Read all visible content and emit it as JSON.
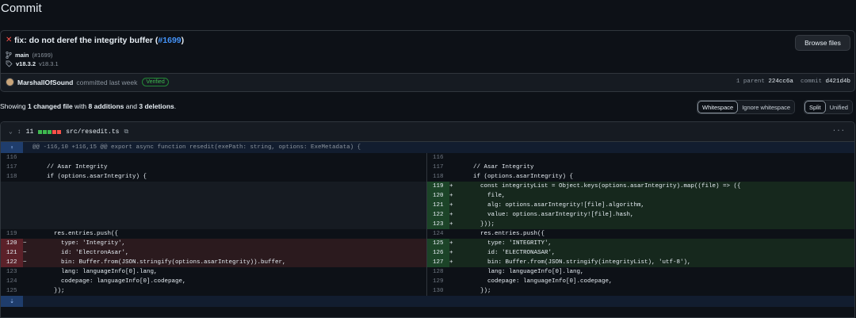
{
  "page": {
    "title": "Commit"
  },
  "commit": {
    "message": "fix: do not deref the integrity buffer (",
    "pr_link": "#1699",
    "message_end": ")",
    "branch": "main",
    "branch_pr": "(#1699)",
    "tag": "v18.3.2",
    "tag_prev": "v18.3.1",
    "browse_label": "Browse files",
    "author": "MarshallOfSound",
    "committed_text": "committed last week",
    "verified_label": "Verified",
    "parent_label": "1 parent",
    "parent_hash": "224cc6a",
    "commit_label": "commit",
    "commit_hash": "d421d4b"
  },
  "summary": {
    "prefix": "Showing",
    "files": "1 changed file",
    "with": "with",
    "additions": "8 additions",
    "and": "and",
    "deletions": "3 deletions",
    "end": "."
  },
  "toggles": {
    "whitespace": "Whitespace",
    "ignore_whitespace": "Ignore whitespace",
    "split": "Split",
    "unified": "Unified"
  },
  "file": {
    "changes": "11",
    "path": "src/resedit.ts",
    "hunk_header": "@@ -116,10 +116,15 @@ export async function resedit(exePath: string, options: ExeMetadata) {",
    "left_lines": [
      {
        "n": "116",
        "m": "",
        "t": "",
        "type": "ctx"
      },
      {
        "n": "117",
        "m": "",
        "t": "    // Asar Integrity",
        "type": "ctx"
      },
      {
        "n": "118",
        "m": "",
        "t": "    if (options.asarIntegrity) {",
        "type": "ctx"
      },
      {
        "n": "",
        "m": "",
        "t": "",
        "type": "empty"
      },
      {
        "n": "",
        "m": "",
        "t": "",
        "type": "empty"
      },
      {
        "n": "",
        "m": "",
        "t": "",
        "type": "empty"
      },
      {
        "n": "",
        "m": "",
        "t": "",
        "type": "empty"
      },
      {
        "n": "",
        "m": "",
        "t": "",
        "type": "empty"
      },
      {
        "n": "119",
        "m": "",
        "t": "      res.entries.push({",
        "type": "ctx"
      },
      {
        "n": "120",
        "m": "−",
        "t": "        type: 'Integrity',",
        "type": "del"
      },
      {
        "n": "121",
        "m": "−",
        "t": "        id: 'ElectronAsar',",
        "type": "del"
      },
      {
        "n": "122",
        "m": "−",
        "t": "        bin: Buffer.from(JSON.stringify(options.asarIntegrity)).buffer,",
        "type": "del"
      },
      {
        "n": "123",
        "m": "",
        "t": "        lang: languageInfo[0].lang,",
        "type": "ctx"
      },
      {
        "n": "124",
        "m": "",
        "t": "        codepage: languageInfo[0].codepage,",
        "type": "ctx"
      },
      {
        "n": "125",
        "m": "",
        "t": "      });",
        "type": "ctx"
      }
    ],
    "right_lines": [
      {
        "n": "116",
        "m": "",
        "t": "",
        "type": "ctx"
      },
      {
        "n": "117",
        "m": "",
        "t": "    // Asar Integrity",
        "type": "ctx"
      },
      {
        "n": "118",
        "m": "",
        "t": "    if (options.asarIntegrity) {",
        "type": "ctx"
      },
      {
        "n": "119",
        "m": "+",
        "t": "      const integrityList = Object.keys(options.asarIntegrity).map((file) => ({",
        "type": "add"
      },
      {
        "n": "120",
        "m": "+",
        "t": "        file,",
        "type": "add"
      },
      {
        "n": "121",
        "m": "+",
        "t": "        alg: options.asarIntegrity![file].algorithm,",
        "type": "add"
      },
      {
        "n": "122",
        "m": "+",
        "t": "        value: options.asarIntegrity![file].hash,",
        "type": "add"
      },
      {
        "n": "123",
        "m": "+",
        "t": "      }));",
        "type": "add"
      },
      {
        "n": "124",
        "m": "",
        "t": "      res.entries.push({",
        "type": "ctx"
      },
      {
        "n": "125",
        "m": "+",
        "t": "        type: 'INTEGRITY',",
        "type": "add"
      },
      {
        "n": "126",
        "m": "+",
        "t": "        id: 'ELECTRONASAR',",
        "type": "add"
      },
      {
        "n": "127",
        "m": "+",
        "t": "        bin: Buffer.from(JSON.stringify(integrityList), 'utf-8'),",
        "type": "add"
      },
      {
        "n": "128",
        "m": "",
        "t": "        lang: languageInfo[0].lang,",
        "type": "ctx"
      },
      {
        "n": "129",
        "m": "",
        "t": "        codepage: languageInfo[0].codepage,",
        "type": "ctx"
      },
      {
        "n": "130",
        "m": "",
        "t": "      });",
        "type": "ctx"
      }
    ]
  }
}
